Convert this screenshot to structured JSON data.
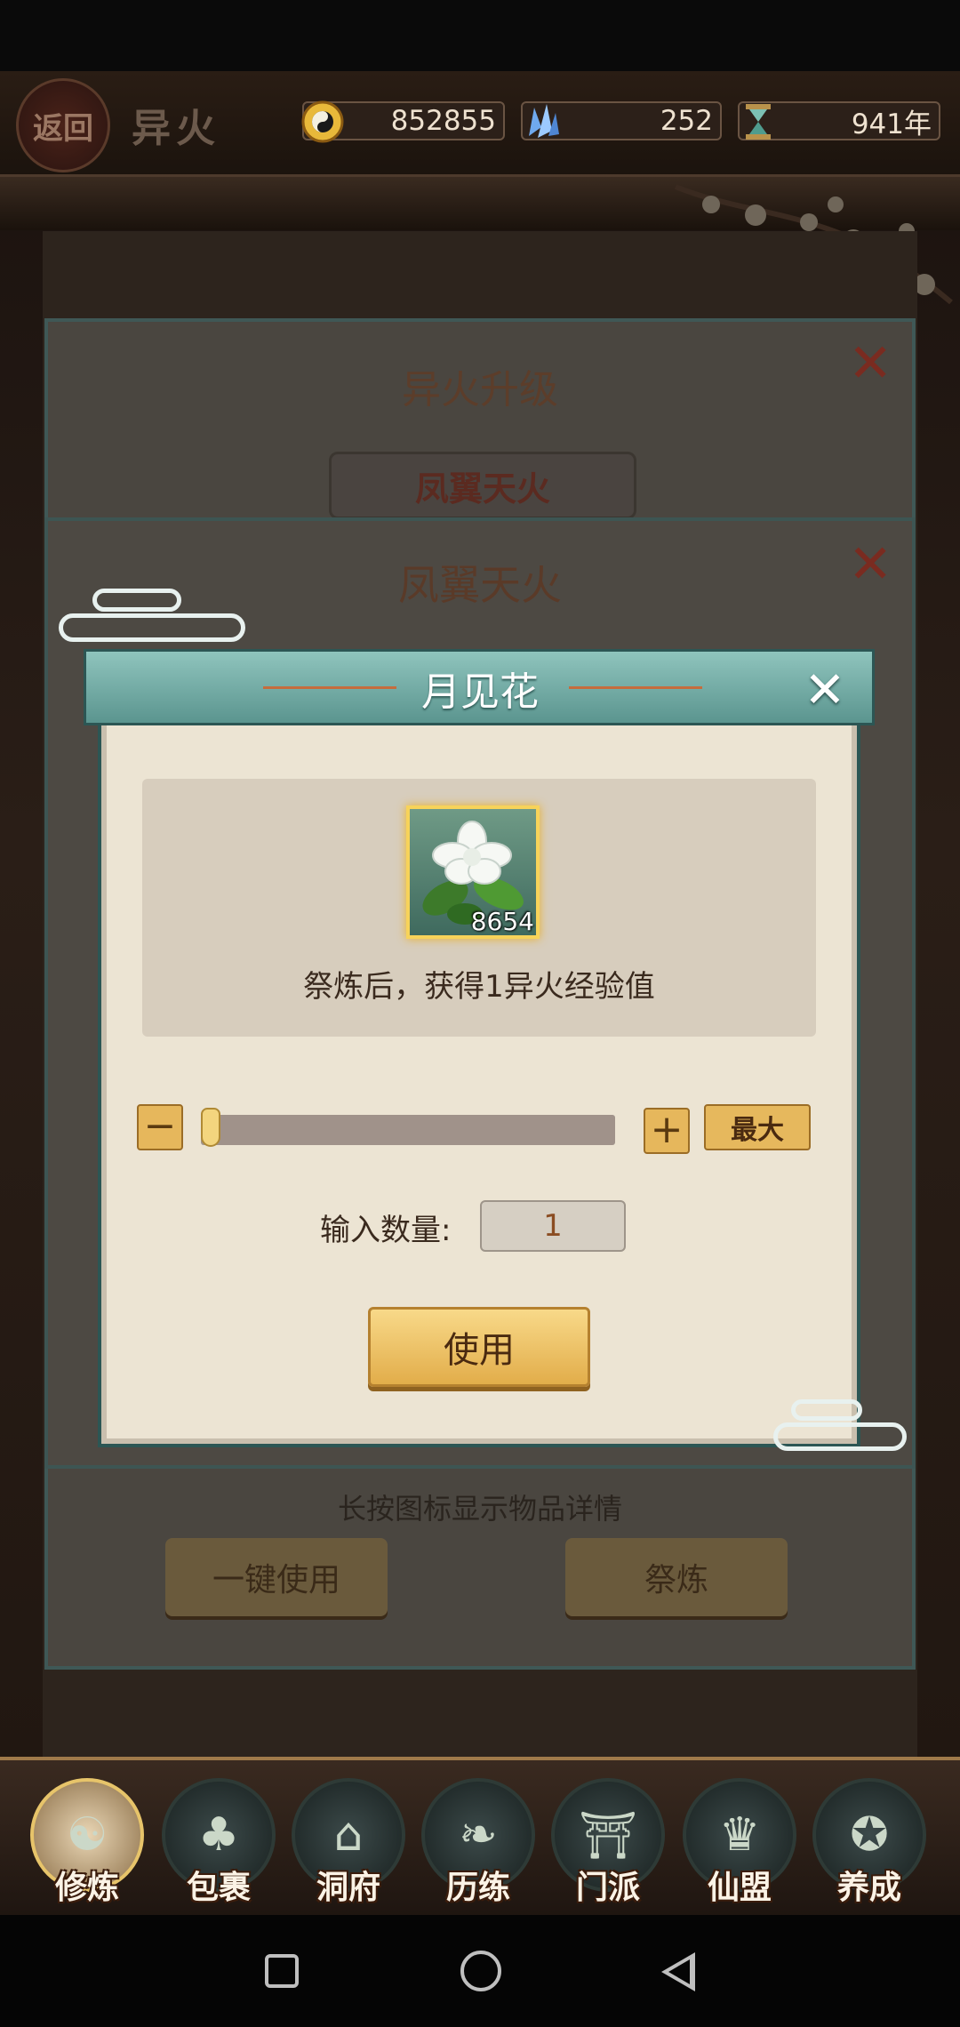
{
  "header": {
    "back_label": "返回",
    "title": "异火",
    "resources": [
      {
        "name": "coin",
        "icon": "yin-yang-coin-icon",
        "value": "852855"
      },
      {
        "name": "spirit-crystal",
        "icon": "crystal-icon",
        "value": "252"
      },
      {
        "name": "lifespan",
        "icon": "hourglass-icon",
        "value": "941年"
      }
    ]
  },
  "background": {
    "upgrade_panel_title": "异火升级",
    "fire_tag": "凤翼天火",
    "fire_panel_title": "凤翼天火",
    "hint": "长按图标显示物品详情",
    "one_click_use": "一键使用",
    "refine": "祭炼"
  },
  "dialog": {
    "title": "月见花",
    "item_count": "8654",
    "description": "祭炼后，获得1异火经验值",
    "minus_label": "−",
    "plus_label": "+",
    "max_label": "最大",
    "quantity_label": "输入数量:",
    "quantity_value": "1",
    "slider_fraction": 0.0,
    "use_label": "使用"
  },
  "nav": {
    "items": [
      {
        "label": "修炼",
        "icon": "cultivator-avatar-icon",
        "active": true
      },
      {
        "label": "包裹",
        "icon": "bag-icon",
        "active": false
      },
      {
        "label": "洞府",
        "icon": "cave-mansion-icon",
        "active": false
      },
      {
        "label": "历练",
        "icon": "scroll-icon",
        "active": false
      },
      {
        "label": "门派",
        "icon": "sect-gate-icon",
        "active": false
      },
      {
        "label": "仙盟",
        "icon": "alliance-icon",
        "active": false
      },
      {
        "label": "养成",
        "icon": "pentagram-icon",
        "active": false
      }
    ]
  },
  "colors": {
    "dialog_header": "#5b958f",
    "gold_button": "#e2ad4a",
    "parchment": "#ece4d3"
  }
}
